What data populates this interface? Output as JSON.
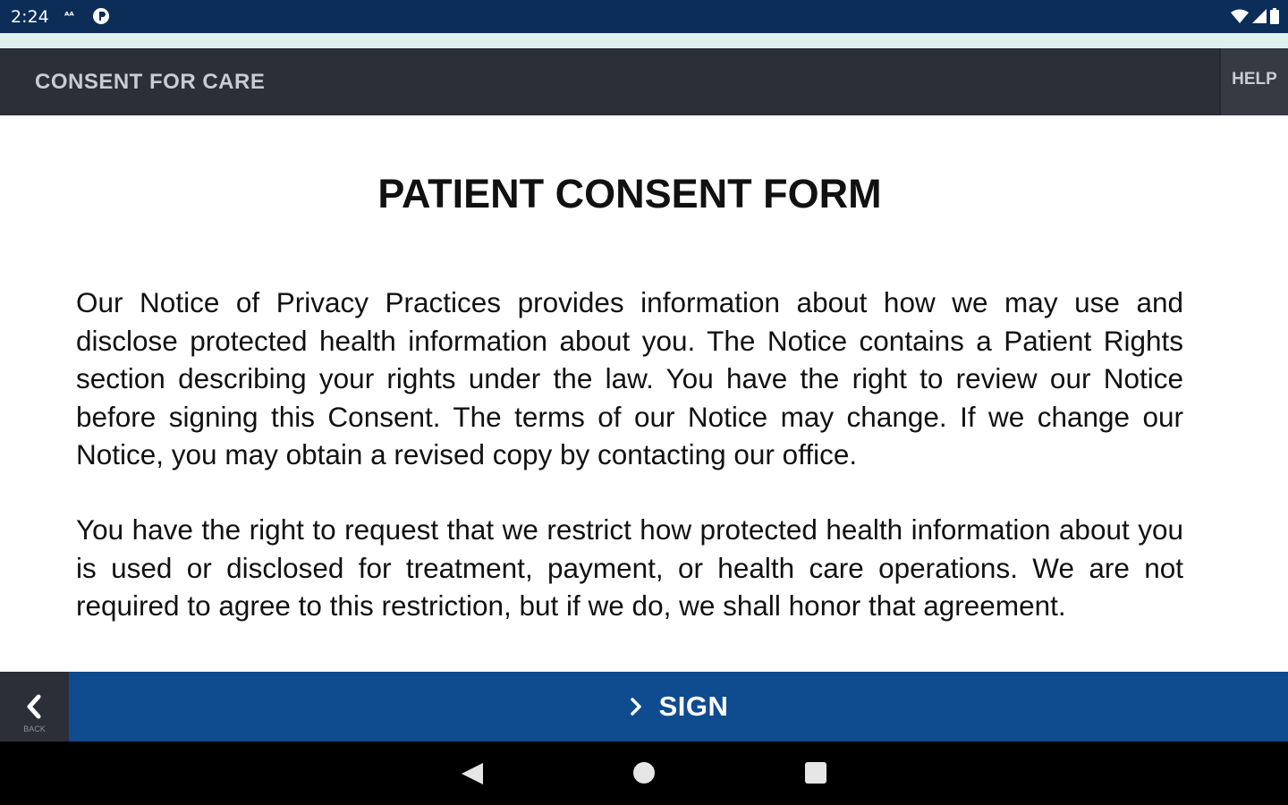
{
  "status_bar": {
    "time": "2:24",
    "left_icons": [
      "accessibility-icon",
      "notification-icon"
    ],
    "right_icons": [
      "wifi-icon",
      "signal-icon",
      "battery-icon"
    ],
    "background": "#0b2d57"
  },
  "app_bar": {
    "title": "CONSENT FOR CARE",
    "help_label": "HELP",
    "background": "#2b2f37"
  },
  "document": {
    "title": "PATIENT CONSENT FORM",
    "paragraphs": [
      "Our Notice of Privacy Practices provides information about how we may use and disclose protected health information about you. The Notice contains a Patient Rights section describing your rights under the law. You have the right to review our Notice before signing this Consent. The terms of our Notice may change. If we change our Notice, you may obtain a revised copy by contacting our office.",
      "You have the right to request that we restrict how protected health information about you is used or disclosed for treatment, payment, or health care operations. We are not required to agree to this restriction, but if we do, we shall honor that agreement."
    ]
  },
  "bottom_bar": {
    "back_label": "BACK",
    "back_icon": "chevron-left-icon",
    "sign_label": "SIGN",
    "sign_icon": "chevron-right-icon",
    "accent": "#0e4b8f"
  },
  "nav_bar": {
    "buttons": [
      "nav-back-icon",
      "nav-home-icon",
      "nav-recents-icon"
    ]
  }
}
